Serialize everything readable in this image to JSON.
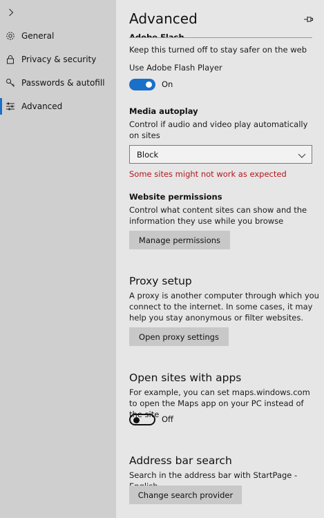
{
  "sidebar": {
    "items": [
      {
        "label": "General",
        "icon": "gear-icon"
      },
      {
        "label": "Privacy & security",
        "icon": "lock-icon"
      },
      {
        "label": "Passwords & autofill",
        "icon": "key-icon"
      },
      {
        "label": "Advanced",
        "icon": "sliders-icon"
      }
    ],
    "active": "Advanced"
  },
  "panel": {
    "title": "Advanced",
    "flash": {
      "heading_cut": "Adobe Flash",
      "desc": "Keep this turned off to stay safer on the web",
      "toggle_label": "Use Adobe Flash Player",
      "toggle_state": "On"
    },
    "autoplay": {
      "heading": "Media autoplay",
      "desc": "Control if audio and video play automatically on sites",
      "selected": "Block",
      "warning": "Some sites might not work as expected"
    },
    "permissions": {
      "heading": "Website permissions",
      "desc": "Control what content sites can show and the information they use while you browse",
      "button": "Manage permissions"
    },
    "proxy": {
      "heading": "Proxy setup",
      "desc": "A proxy is another computer through which you connect to the internet. In some cases, it may help you stay anonymous or filter websites.",
      "button": "Open proxy settings"
    },
    "apps": {
      "heading": "Open sites with apps",
      "desc": "For example, you can set maps.windows.com to open the Maps app on your PC instead of the site",
      "toggle_state": "Off"
    },
    "search": {
      "heading": "Address bar search",
      "desc": "Search in the address bar with StartPage - English",
      "button": "Change search provider"
    }
  },
  "colors": {
    "accent": "#1a6fc9",
    "warning": "#b3161f",
    "sidebar_bg": "#cfcfcf",
    "panel_bg": "#e6e6e6"
  }
}
